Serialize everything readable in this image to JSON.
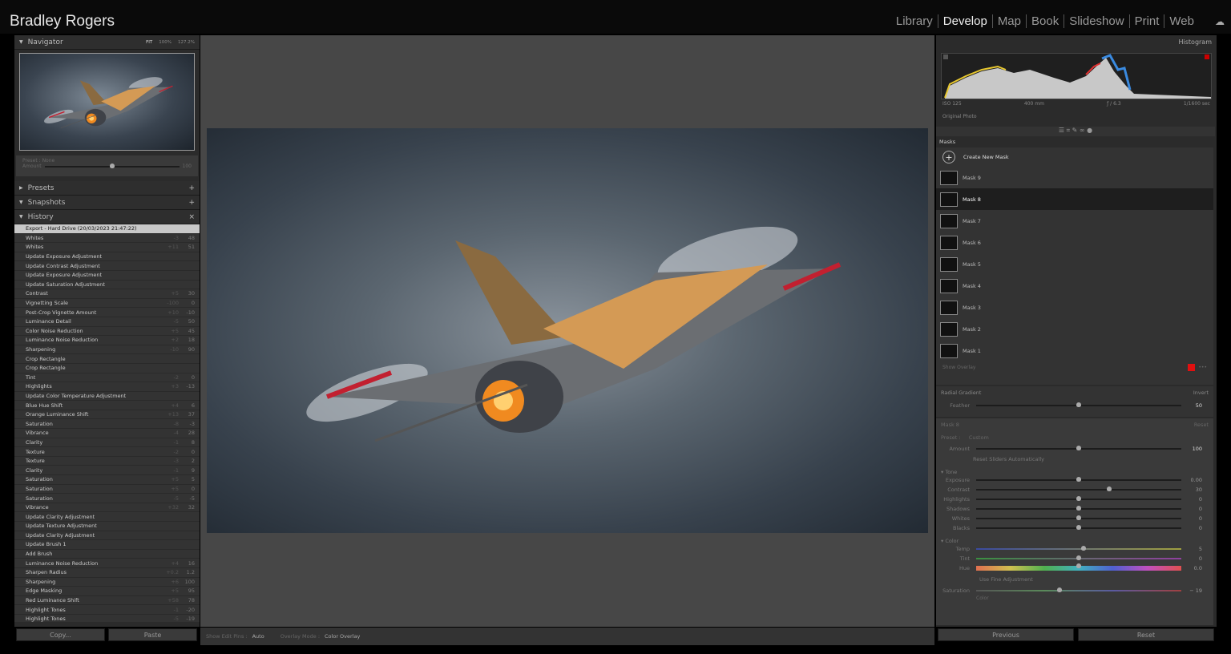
{
  "identity": "Bradley Rogers",
  "modules": [
    "Library",
    "Develop",
    "Map",
    "Book",
    "Slideshow",
    "Print",
    "Web"
  ],
  "active_module": "Develop",
  "navigator": {
    "title": "Navigator",
    "zoom": [
      "FIT",
      "100%",
      "127.2%"
    ]
  },
  "quick_preset": {
    "preset_label": "Preset :",
    "preset_value": "None",
    "amount_label": "Amount",
    "amount_value": "100",
    "amount_fraction": 0.5
  },
  "panels": {
    "presets": "Presets",
    "snapshots": "Snapshots",
    "history": "History"
  },
  "history": [
    {
      "n": "Export - Hard Drive (20/03/2023 21:47:22)",
      "d": "",
      "v": ""
    },
    {
      "n": "Whites",
      "d": "-3",
      "v": "48"
    },
    {
      "n": "Whites",
      "d": "+11",
      "v": "51"
    },
    {
      "n": "Update Exposure Adjustment",
      "d": "",
      "v": ""
    },
    {
      "n": "Update Contrast Adjustment",
      "d": "",
      "v": ""
    },
    {
      "n": "Update Exposure Adjustment",
      "d": "",
      "v": ""
    },
    {
      "n": "Update Saturation Adjustment",
      "d": "",
      "v": ""
    },
    {
      "n": "Contrast",
      "d": "+5",
      "v": "30"
    },
    {
      "n": "Vignetting Scale",
      "d": "-100",
      "v": "0"
    },
    {
      "n": "Post-Crop Vignette Amount",
      "d": "+10",
      "v": "-10"
    },
    {
      "n": "Luminance Detail",
      "d": "-5",
      "v": "50"
    },
    {
      "n": "Color Noise Reduction",
      "d": "+5",
      "v": "45"
    },
    {
      "n": "Luminance Noise Reduction",
      "d": "+2",
      "v": "18"
    },
    {
      "n": "Sharpening",
      "d": "-10",
      "v": "90"
    },
    {
      "n": "Crop Rectangle",
      "d": "",
      "v": ""
    },
    {
      "n": "Crop Rectangle",
      "d": "",
      "v": ""
    },
    {
      "n": "Tint",
      "d": "-2",
      "v": "0"
    },
    {
      "n": "Highlights",
      "d": "+3",
      "v": "-13"
    },
    {
      "n": "Update Color Temperature Adjustment",
      "d": "",
      "v": ""
    },
    {
      "n": "Blue Hue Shift",
      "d": "+4",
      "v": "6"
    },
    {
      "n": "Orange Luminance Shift",
      "d": "+13",
      "v": "37"
    },
    {
      "n": "Saturation",
      "d": "-8",
      "v": "-3"
    },
    {
      "n": "Vibrance",
      "d": "-4",
      "v": "28"
    },
    {
      "n": "Clarity",
      "d": "-1",
      "v": "8"
    },
    {
      "n": "Texture",
      "d": "-2",
      "v": "0"
    },
    {
      "n": "Texture",
      "d": "-3",
      "v": "2"
    },
    {
      "n": "Clarity",
      "d": "-1",
      "v": "9"
    },
    {
      "n": "Saturation",
      "d": "+5",
      "v": "5"
    },
    {
      "n": "Saturation",
      "d": "+5",
      "v": "0"
    },
    {
      "n": "Saturation",
      "d": "-5",
      "v": "-5"
    },
    {
      "n": "Vibrance",
      "d": "+32",
      "v": "32"
    },
    {
      "n": "Update Clarity Adjustment",
      "d": "",
      "v": ""
    },
    {
      "n": "Update Texture Adjustment",
      "d": "",
      "v": ""
    },
    {
      "n": "Update Clarity Adjustment",
      "d": "",
      "v": ""
    },
    {
      "n": "Update Brush 1",
      "d": "",
      "v": ""
    },
    {
      "n": "Add Brush",
      "d": "",
      "v": ""
    },
    {
      "n": "Luminance Noise Reduction",
      "d": "+4",
      "v": "16"
    },
    {
      "n": "Sharpen Radius",
      "d": "+0.2",
      "v": "1.2"
    },
    {
      "n": "Sharpening",
      "d": "+6",
      "v": "100"
    },
    {
      "n": "Edge Masking",
      "d": "+5",
      "v": "95"
    },
    {
      "n": "Red Luminance Shift",
      "d": "+58",
      "v": "78"
    },
    {
      "n": "Highlight Tones",
      "d": "-1",
      "v": "-20"
    },
    {
      "n": "Highlight Tones",
      "d": "-5",
      "v": "-19"
    }
  ],
  "left_buttons": {
    "copy": "Copy...",
    "paste": "Paste"
  },
  "toolbar": {
    "pins_label": "Show Edit Pins :",
    "pins_value": "Auto",
    "overlay_label": "Overlay Mode :",
    "overlay_value": "Color Overlay"
  },
  "histogram": {
    "title": "Histogram",
    "iso": "ISO 125",
    "focal": "400 mm",
    "aperture": "ƒ / 6.3",
    "shutter": "1/1600 sec",
    "original": "Original Photo"
  },
  "masks": {
    "title": "Masks",
    "create": "Create New Mask",
    "items": [
      "Mask 9",
      "Mask 8",
      "Mask 7",
      "Mask 6",
      "Mask 5",
      "Mask 4",
      "Mask 3",
      "Mask 2",
      "Mask 1"
    ],
    "selected": "Mask 8",
    "show_overlay": "Show Overlay",
    "overlay_color": "#e01010"
  },
  "radial": {
    "title": "Radial Gradient",
    "invert": "Invert",
    "feather_label": "Feather",
    "feather_value": "50",
    "feather_fraction": 0.5
  },
  "mask_edit": {
    "name": "Mask 8",
    "reset": "Reset",
    "preset_label": "Preset :",
    "preset_value": "Custom",
    "amount_label": "Amount",
    "amount_value": "100",
    "amount_fraction": 0.5,
    "reset_sliders": "Reset Sliders Automatically"
  },
  "tone": {
    "title": "Tone",
    "sliders": [
      {
        "l": "Exposure",
        "v": "0.00",
        "f": 0.5
      },
      {
        "l": "Contrast",
        "v": "30",
        "f": 0.65
      },
      {
        "l": "Highlights",
        "v": "0",
        "f": 0.5
      },
      {
        "l": "Shadows",
        "v": "0",
        "f": 0.5
      },
      {
        "l": "Whites",
        "v": "0",
        "f": 0.5
      },
      {
        "l": "Blacks",
        "v": "0",
        "f": 0.5
      }
    ]
  },
  "color": {
    "title": "Color",
    "temp": {
      "l": "Temp",
      "v": "5",
      "f": 0.525
    },
    "tint": {
      "l": "Tint",
      "v": "0",
      "f": 0.5
    },
    "hue": {
      "l": "Hue",
      "v": "0.0",
      "f": 0.5
    },
    "fine": "Use Fine Adjustment",
    "saturation": {
      "l": "Saturation",
      "v": "− 19",
      "f": 0.405
    },
    "color_label": "Color"
  },
  "right_buttons": {
    "previous": "Previous",
    "reset": "Reset"
  }
}
